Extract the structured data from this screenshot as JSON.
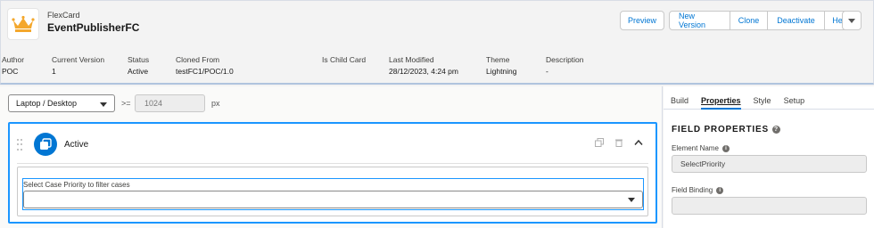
{
  "header": {
    "object_type": "FlexCard",
    "card_name": "EventPublisherFC",
    "buttons": {
      "preview": "Preview",
      "new_version": "New Version",
      "clone": "Clone",
      "deactivate": "Deactivate",
      "help": "Help"
    },
    "meta": [
      {
        "label": "Author",
        "value": "POC"
      },
      {
        "label": "Current Version",
        "value": "1"
      },
      {
        "label": "Status",
        "value": "Active"
      },
      {
        "label": "Cloned From",
        "value": "testFC1/POC/1.0"
      },
      {
        "label": "Is Child Card",
        "value": ""
      },
      {
        "label": "Last Modified",
        "value": "28/12/2023, 4:24 pm"
      },
      {
        "label": "Theme",
        "value": "Lightning"
      },
      {
        "label": "Description",
        "value": "-"
      }
    ]
  },
  "canvas": {
    "device_select": "Laptop / Desktop",
    "gte_symbol": ">=",
    "width_value": "1024",
    "unit": "px",
    "state": {
      "label": "Active",
      "field_label": "Select Case Priority to filter cases"
    }
  },
  "panel": {
    "tabs": [
      "Build",
      "Properties",
      "Style",
      "Setup"
    ],
    "title": "FIELD PROPERTIES",
    "element_name_label": "Element Name",
    "element_name_value": "SelectPriority",
    "field_binding_label": "Field Binding",
    "field_binding_value": ""
  },
  "colors": {
    "brand": "#0176d3",
    "focus": "#1b96ff",
    "logo_crown": "#f4a72c"
  }
}
